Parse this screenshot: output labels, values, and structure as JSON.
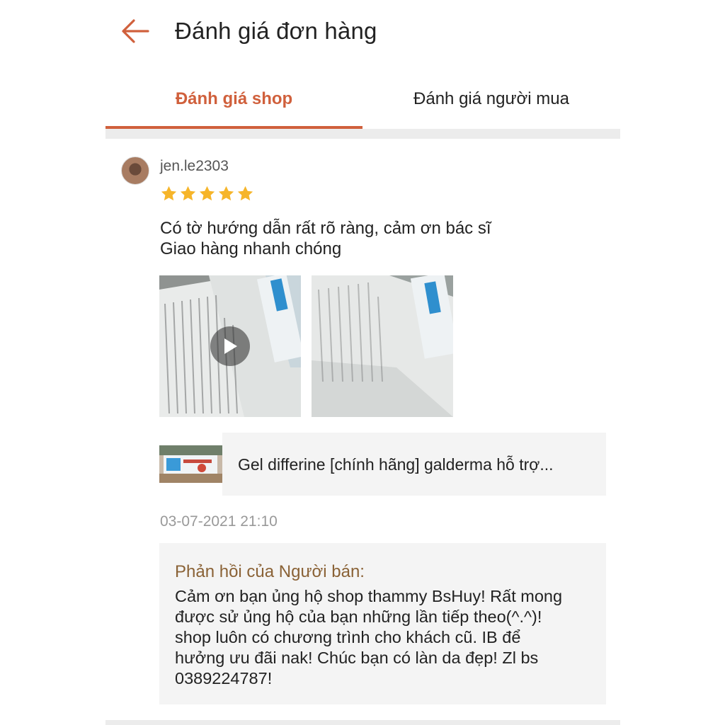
{
  "header": {
    "title": "Đánh giá đơn hàng",
    "back_icon": "arrow-left-icon"
  },
  "tabs": [
    {
      "label": "Đánh giá shop",
      "active": true
    },
    {
      "label": "Đánh giá người mua",
      "active": false
    }
  ],
  "colors": {
    "accent": "#d0603c",
    "star": "#f6b52a",
    "reply_title": "#8a6236",
    "muted": "#999999"
  },
  "review": {
    "username": "jen.le2303",
    "rating": 5,
    "max_rating": 5,
    "comment_lines": [
      "Có tờ hướng dẫn rất rõ ràng, cảm ơn bác sĩ",
      "Giao hàng nhanh chóng"
    ],
    "media": [
      {
        "type": "video",
        "icon": "play-icon"
      },
      {
        "type": "image"
      }
    ],
    "product_name": "Gel differine [chính hãng] galderma hỗ trợ...",
    "timestamp": "03-07-2021 21:10",
    "seller_reply": {
      "title": "Phản hồi của Người bán:",
      "lines": [
        "Cảm ơn bạn ủng hộ shop thammy BsHuy! Rất mong",
        "được sử ủng hộ của bạn những lần tiếp theo(^.^)!",
        "shop luôn có chương trình cho khách cũ. IB để",
        "hưởng ưu đãi nak! Chúc bạn có làn da đẹp! Zl bs",
        "0389224787!"
      ]
    }
  }
}
